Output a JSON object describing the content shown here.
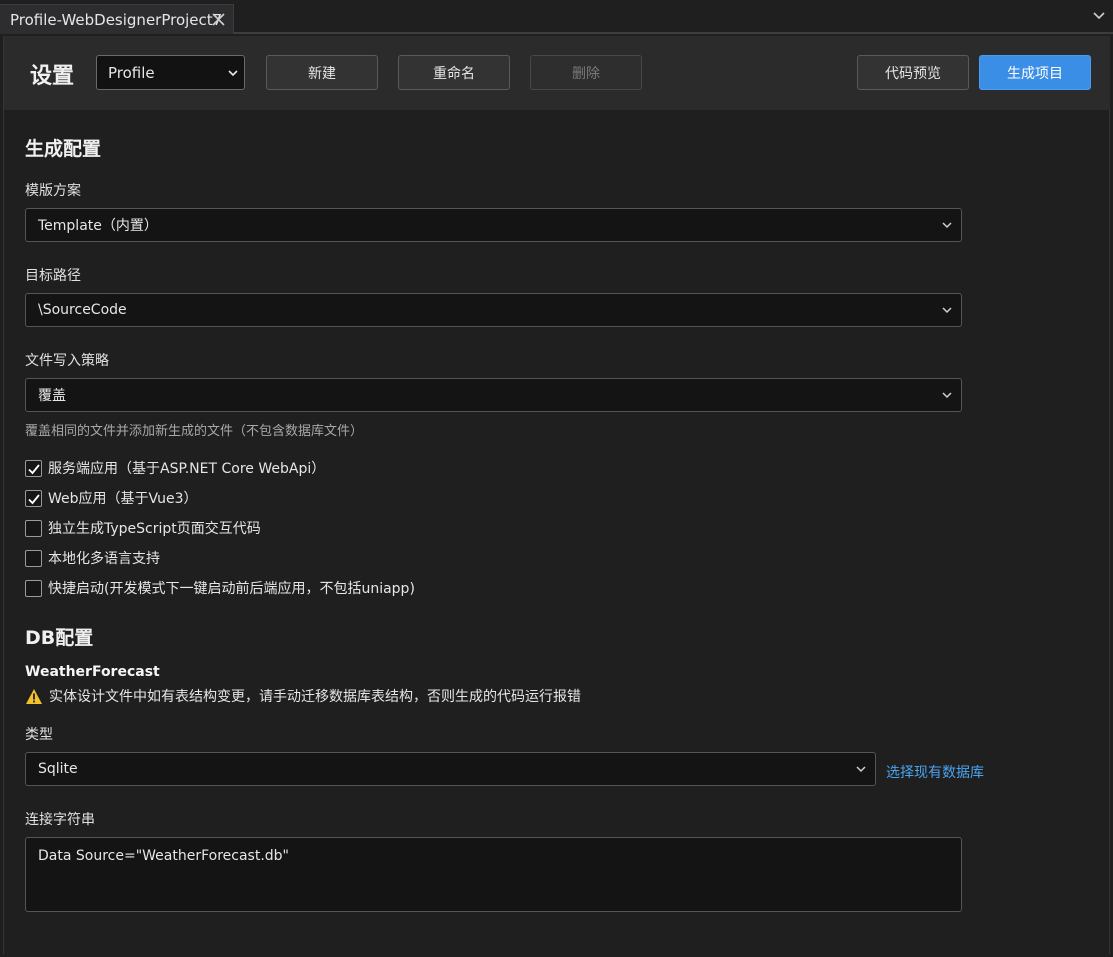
{
  "tab": {
    "title": "Profile-WebDesignerProject7"
  },
  "toolbar": {
    "title": "设置",
    "profile_select": "Profile",
    "new_label": "新建",
    "rename_label": "重命名",
    "delete_label": "删除",
    "preview_label": "代码预览",
    "generate_label": "生成项目",
    "primary_color": "#3a8ee6"
  },
  "gen_config": {
    "title": "生成配置",
    "template": {
      "label": "模版方案",
      "value": "Template（内置）"
    },
    "target_path": {
      "label": "目标路径",
      "value": "\\SourceCode"
    },
    "write_policy": {
      "label": "文件写入策略",
      "value": "覆盖",
      "hint": "覆盖相同的文件并添加新生成的文件（不包含数据库文件）"
    },
    "options": [
      {
        "label": "服务端应用（基于ASP.NET Core WebApi）",
        "checked": true
      },
      {
        "label": "Web应用（基于Vue3）",
        "checked": true
      },
      {
        "label": "独立生成TypeScript页面交互代码",
        "checked": false
      },
      {
        "label": "本地化多语言支持",
        "checked": false
      },
      {
        "label": "快捷启动(开发模式下一键启动前后端应用，不包括uniapp)",
        "checked": false
      }
    ]
  },
  "db_config": {
    "title": "DB配置",
    "entity": "WeatherForecast",
    "warning_icon": "warning-icon",
    "warning": "实体设计文件中如有表结构变更，请手动迁移数据库表结构，否则生成的代码运行报错",
    "type_label": "类型",
    "type_value": "Sqlite",
    "select_existing": "选择现有数据库",
    "conn_label": "连接字符串",
    "conn_value": "Data Source=\"WeatherForecast.db\""
  }
}
